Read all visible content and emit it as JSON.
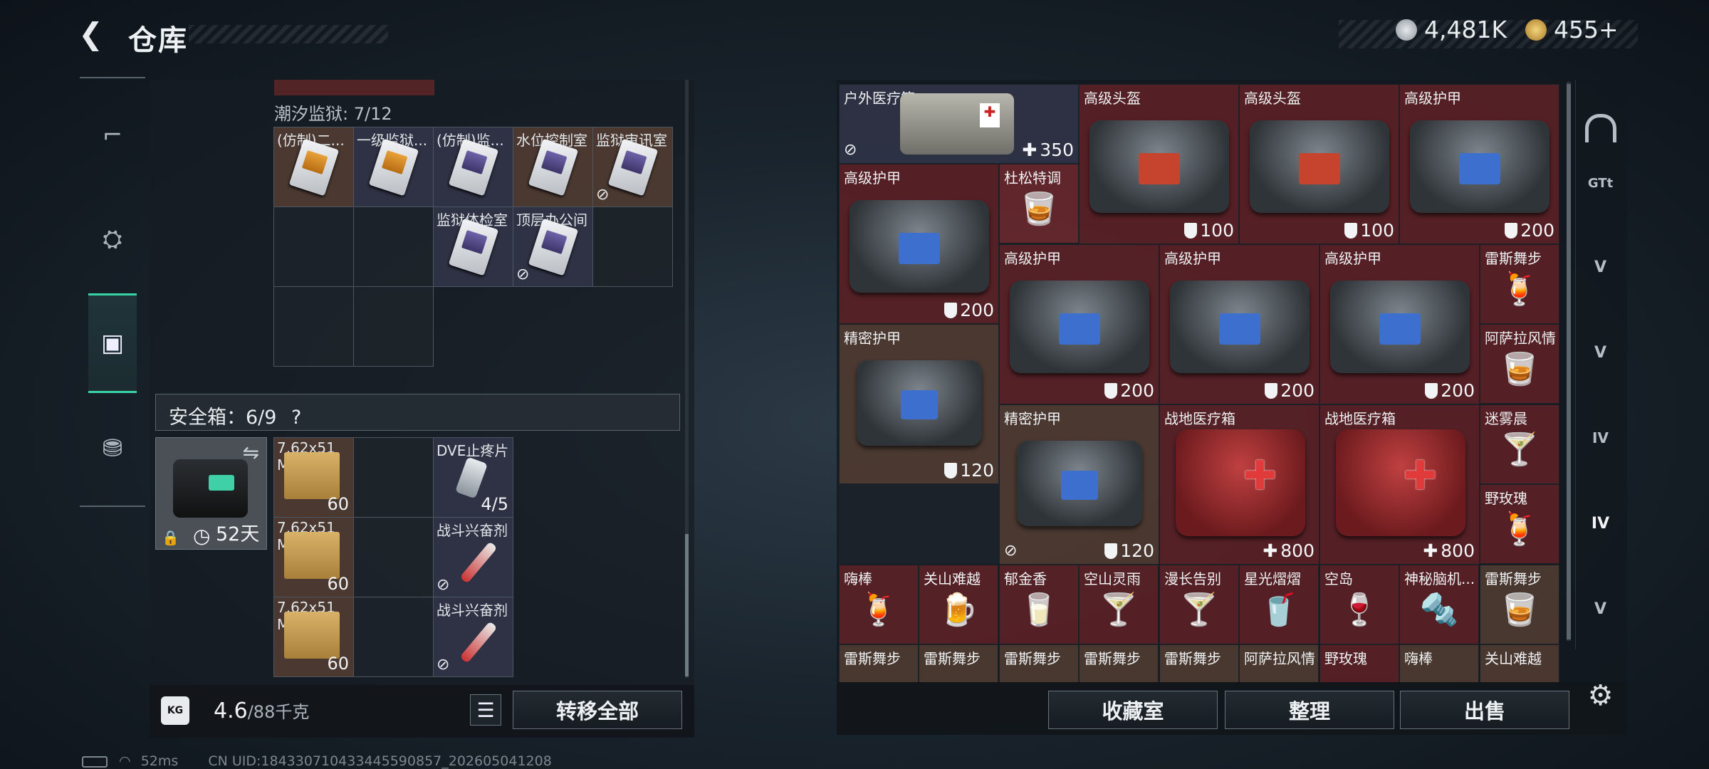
{
  "header": {
    "back_glyph": "❮",
    "title": "仓库",
    "currency1": "4,481K",
    "currency2": "455+",
    "currency1_icon": "silver-coin-icon",
    "currency2_icon": "gold-coin-icon"
  },
  "left_rail": [
    {
      "icon": "gun-icon",
      "glyph": "⌐"
    },
    {
      "icon": "backpack-icon",
      "glyph": "⛭"
    },
    {
      "icon": "case-icon",
      "glyph": "▣"
    },
    {
      "icon": "toolbox-icon",
      "glyph": "⛃"
    }
  ],
  "keycards": {
    "label": "潮汐监狱: 7/12",
    "items": [
      "(仿制)二...",
      "一级监狱...",
      "(仿制)监...",
      "水位控制室",
      "监狱审讯室",
      "监狱体检室",
      "顶层办公间"
    ]
  },
  "safe_box": {
    "label": "安全箱：6/9",
    "help": "?",
    "days": "52天",
    "swap": "⇋",
    "lock": "🔒",
    "clock": "◷"
  },
  "safe_items": [
    {
      "name": "7.62x51 M80",
      "count": "60"
    },
    {
      "name": "DVE止疼片",
      "count": "4/5"
    },
    {
      "name": "7.62x51 M80",
      "count": "60"
    },
    {
      "name": "战斗兴奋剂",
      "count": ""
    },
    {
      "name": "7.62x51 M80",
      "count": "60"
    },
    {
      "name": "战斗兴奋剂",
      "count": ""
    }
  ],
  "footer": {
    "weight_value": "4.6",
    "weight_max": "/88千克",
    "kg_icon": "KG",
    "transfer_all": "转移全部",
    "list_glyph": "☰"
  },
  "stash": {
    "row1": [
      {
        "name": "户外医疗箱",
        "value": "350"
      },
      {
        "name": "高级头盔",
        "value": "100"
      },
      {
        "name": "高级头盔",
        "value": "100"
      },
      {
        "name": "高级护甲",
        "value": "200"
      }
    ],
    "row2": [
      {
        "name": "高级护甲",
        "value": "200"
      },
      {
        "name": "杜松特调",
        "value": ""
      }
    ],
    "row3": [
      {
        "name": "高级护甲",
        "value": "200"
      },
      {
        "name": "高级护甲",
        "value": "200"
      },
      {
        "name": "高级护甲",
        "value": "200"
      },
      {
        "name": "雷斯舞步",
        "value": ""
      }
    ],
    "row4": [
      {
        "name": "精密护甲",
        "value": "120"
      },
      {
        "name": "阿萨拉风情",
        "value": ""
      }
    ],
    "row5": [
      {
        "name": "精密护甲",
        "value": "120"
      },
      {
        "name": "战地医疗箱",
        "value": "800"
      },
      {
        "name": "战地医疗箱",
        "value": "800"
      },
      {
        "name": "迷雾晨",
        "value": ""
      },
      {
        "name": "野玫瑰",
        "value": ""
      }
    ],
    "drinks": [
      "嗨棒",
      "关山难越",
      "郁金香",
      "空山灵雨",
      "漫长告别",
      "星光熠熠",
      "空岛",
      "神秘脑机...",
      "雷斯舞步"
    ],
    "drinks2": [
      "雷斯舞步",
      "雷斯舞步",
      "雷斯舞步",
      "雷斯舞步",
      "雷斯舞步",
      "阿萨拉风情",
      "野玫瑰",
      "嗨棒",
      "关山难越"
    ]
  },
  "right_buttons": {
    "collection": "收藏室",
    "organize": "整理",
    "sell": "出售"
  },
  "right_rail": [
    "vault-icon",
    "gtimer-icon",
    "v-case-icon",
    "v-case-icon",
    "iv-case-icon",
    "iv-plus-case-icon",
    "v-case-icon",
    "settings-icon"
  ],
  "right_rail_labels": {
    "gt": "GTt",
    "v": "V",
    "iv": "IV"
  },
  "status": {
    "ping": "52ms",
    "uid": "CN UID:184330710433445590857_202605041208"
  },
  "colors": {
    "accent": "#39d3a5",
    "red_cell": "#662228",
    "brown_cell": "#584034",
    "navy_cell": "#32364a"
  }
}
